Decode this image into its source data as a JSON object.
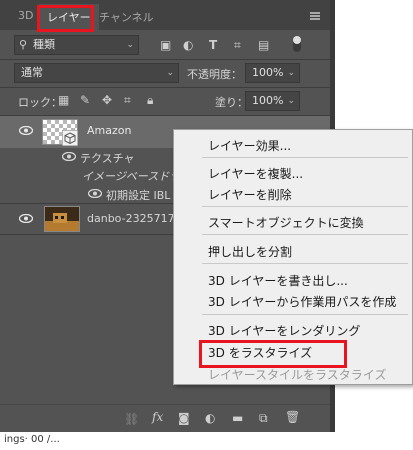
{
  "tabs": {
    "tab_3d": "3D",
    "tab_layers": "レイヤー",
    "tab_channels": "チャンネル"
  },
  "filter": {
    "kind_label": "種類"
  },
  "blend": {
    "mode": "通常",
    "opacity_label": "不透明度：",
    "opacity_value": "100%"
  },
  "lock": {
    "label": "ロック：",
    "fill_label": "塗り：",
    "fill_value": "100%"
  },
  "layers": {
    "amazon_name": "Amazon",
    "texture_label": "テクスチャ",
    "image_based_label": "イメージベースドライ",
    "ibl_label": "初期設定 IBL",
    "danbo_name": "danbo-2325717"
  },
  "context_menu": {
    "items": [
      "レイヤー効果...",
      "レイヤーを複製...",
      "レイヤーを削除",
      "スマートオブジェクトに変換",
      "押し出しを分割",
      "3D レイヤーを書き出し...",
      "3D レイヤーから作業用パスを作成",
      "3D レイヤーをレンダリング",
      "3D をラスタライズ",
      "レイヤースタイルをラスタライズ"
    ]
  },
  "bottom": {
    "fx_label": "fx"
  },
  "below_text": "ings· 00 /..."
}
